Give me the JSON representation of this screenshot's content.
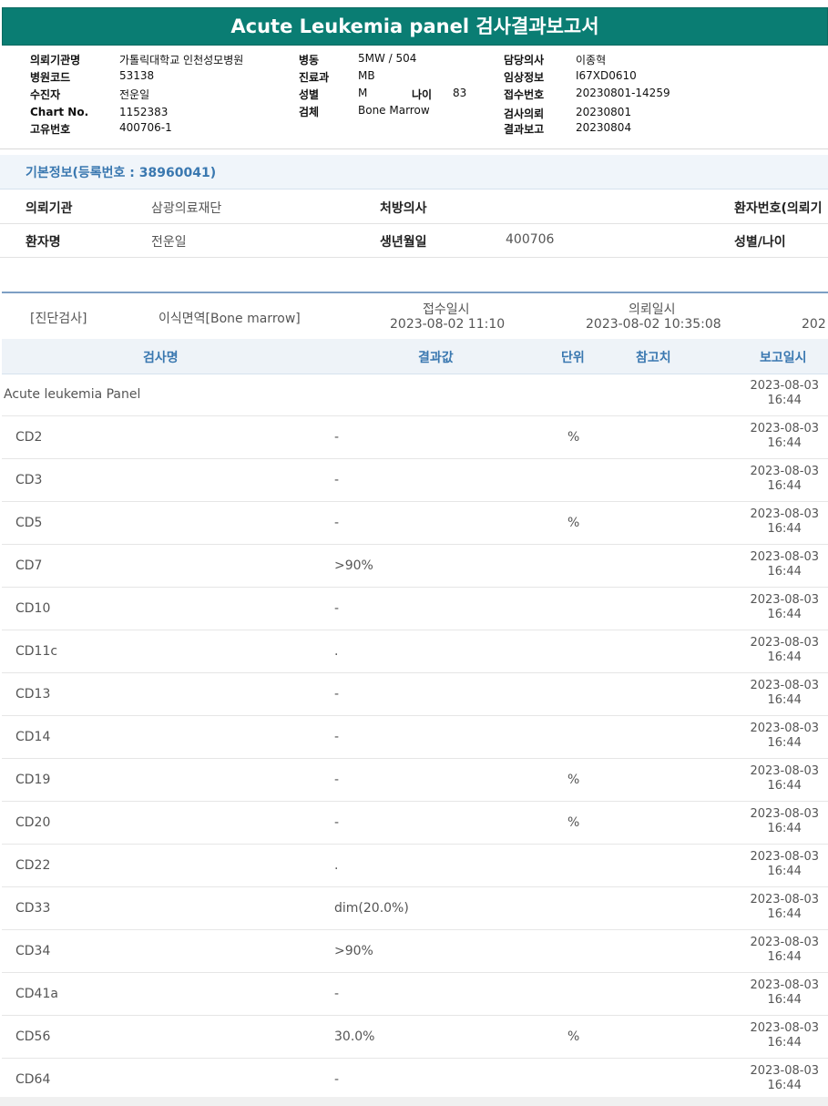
{
  "title": "Acute Leukemia panel 검사결과보고서",
  "report": {
    "left": [
      {
        "label": "의뢰기관명",
        "value": "가톨릭대학교 인천성모병원"
      },
      {
        "label": "병원코드",
        "value": "53138"
      },
      {
        "label": "수진자",
        "value": "전운일"
      },
      {
        "label": "Chart No.",
        "value": "1152383"
      },
      {
        "label": "고유번호",
        "value": "400706-1"
      }
    ],
    "mid": [
      {
        "label": "병동",
        "value": "5MW / 504"
      },
      {
        "label": "진료과",
        "value": "MB"
      },
      {
        "label": "성별",
        "value": "M"
      },
      {
        "label": "검체",
        "value": "Bone Marrow"
      }
    ],
    "age_label": "나이",
    "age_value": "83",
    "right": [
      {
        "label": "담당의사",
        "value": "이종혁"
      },
      {
        "label": "임상정보",
        "value": "I67XD0610"
      },
      {
        "label": "접수번호",
        "value": "20230801-14259"
      },
      {
        "label": "검사의뢰",
        "value": "20230801"
      },
      {
        "label": "결과보고",
        "value": "20230804"
      }
    ]
  },
  "basic_info": {
    "header": "기본정보(등록번호 : 38960041)",
    "row1": {
      "inst_label": "의뢰기관",
      "inst_value": "삼광의료재단",
      "doctor_label": "처방의사",
      "doctor_value": "",
      "patno_label": "환자번호(의뢰기"
    },
    "row2": {
      "name_label": "환자명",
      "name_value": "전운일",
      "birth_label": "생년월일",
      "birth_value": "400706",
      "sex_label": "성별/나이"
    }
  },
  "diagnosis": {
    "category": "[진단검사]",
    "test": "이식면역[Bone marrow]",
    "received_label": "접수일시",
    "received_value": "2023-08-02 11:10",
    "requested_label": "의뢰일시",
    "requested_value": "2023-08-02 10:35:08",
    "truncated": "202"
  },
  "table": {
    "headers": {
      "name": "검사명",
      "result": "결과값",
      "unit": "단위",
      "ref": "참고치",
      "report_date": "보고일시"
    },
    "rows": [
      {
        "name": "Acute leukemia Panel",
        "result": "",
        "unit": "",
        "date": "2023-08-03",
        "time": "16:44"
      },
      {
        "name": "CD2",
        "result": "-",
        "unit": "%",
        "date": "2023-08-03",
        "time": "16:44"
      },
      {
        "name": "CD3",
        "result": "-",
        "unit": "",
        "date": "2023-08-03",
        "time": "16:44"
      },
      {
        "name": "CD5",
        "result": "-",
        "unit": "%",
        "date": "2023-08-03",
        "time": "16:44"
      },
      {
        "name": "CD7",
        "result": ">90%",
        "unit": "",
        "date": "2023-08-03",
        "time": "16:44"
      },
      {
        "name": "CD10",
        "result": "-",
        "unit": "",
        "date": "2023-08-03",
        "time": "16:44"
      },
      {
        "name": "CD11c",
        "result": ".",
        "unit": "",
        "date": "2023-08-03",
        "time": "16:44"
      },
      {
        "name": "CD13",
        "result": "-",
        "unit": "",
        "date": "2023-08-03",
        "time": "16:44"
      },
      {
        "name": "CD14",
        "result": "-",
        "unit": "",
        "date": "2023-08-03",
        "time": "16:44"
      },
      {
        "name": "CD19",
        "result": "-",
        "unit": "%",
        "date": "2023-08-03",
        "time": "16:44"
      },
      {
        "name": "CD20",
        "result": "-",
        "unit": "%",
        "date": "2023-08-03",
        "time": "16:44"
      },
      {
        "name": "CD22",
        "result": ".",
        "unit": "",
        "date": "2023-08-03",
        "time": "16:44"
      },
      {
        "name": "CD33",
        "result": "dim(20.0%)",
        "unit": "",
        "date": "2023-08-03",
        "time": "16:44"
      },
      {
        "name": "CD34",
        "result": ">90%",
        "unit": "",
        "date": "2023-08-03",
        "time": "16:44"
      },
      {
        "name": "CD41a",
        "result": "-",
        "unit": "",
        "date": "2023-08-03",
        "time": "16:44"
      },
      {
        "name": "CD56",
        "result": "30.0%",
        "unit": "%",
        "date": "2023-08-03",
        "time": "16:44"
      },
      {
        "name": "CD64",
        "result": "-",
        "unit": "",
        "date": "2023-08-03",
        "time": "16:44"
      }
    ]
  }
}
